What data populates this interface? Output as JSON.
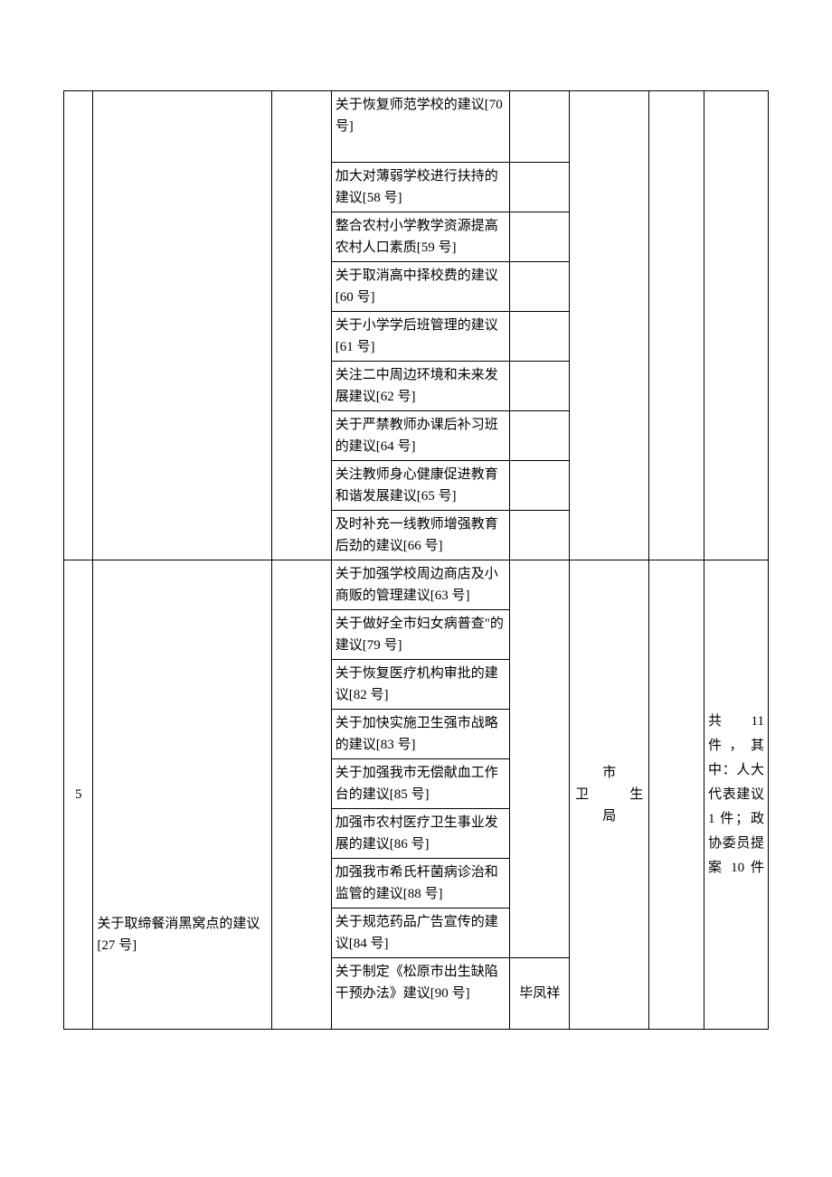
{
  "row1_items": [
    "关于恢复师范学校的建议[70 号]",
    "加大对薄弱学校进行扶持的建议[58 号]",
    "整合农村小学教学资源提高农村人口素质[59 号]",
    "关于取消高中择校费的建议[60 号]",
    "关于小学学后班管理的建议[61 号]",
    "关注二中周边环境和未来发展建议[62 号]",
    "关于严禁教师办课后补习班的建议[64 号]",
    "关注教师身心健康促进教育和谐发展建议[65 号]",
    "及时补充一线教师增强教育后劲的建议[66 号]"
  ],
  "row2": {
    "idx": "5",
    "renda": "关于取缔餐消黑窝点的建议[27 号]",
    "unit_line1": "市",
    "unit_line2": "卫　生",
    "unit_line3": "局",
    "remark": "共 11 件，其中：人大代表建议 1 件；政协委员提案 10 件",
    "items": [
      "关于加强学校周边商店及小商贩的管理建议[63 号]",
      "关于做好全市妇女病普查\"的建议[79 号]",
      "关于恢复医疗机构审批的建议[82 号]",
      "关于加快实施卫生强市战略的建议[83 号]",
      "关于加强我市无偿献血工作台的建议[85 号]",
      "加强市农村医疗卫生事业发展的建议[86 号]",
      "加强我市希氏杆菌病诊治和监管的建议[88 号]",
      "关于规范药品广告宣传的建议[84 号]"
    ],
    "item90": "关于制定《松原市出生缺陷干预办法》建议[90 号]",
    "person90": "毕凤祥"
  }
}
